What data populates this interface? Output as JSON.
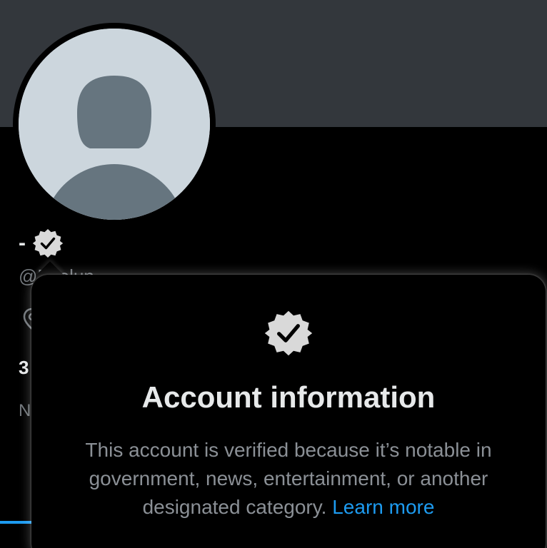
{
  "profile": {
    "display_name": "-",
    "handle_visible": "@D",
    "handle_partial": "lielun",
    "stat_count_partial": "3",
    "tab_label_partial": "N"
  },
  "icons": {
    "avatar": "default-avatar-silhouette",
    "verified": "verified-badge-icon",
    "location": "location-pin-icon"
  },
  "colors": {
    "banner": "#33373c",
    "avatar_bg": "#ccd6dd",
    "avatar_figure": "#66757f",
    "accent": "#1d9bf0",
    "badge": "#d9d9d9"
  },
  "hovercard": {
    "title": "Account information",
    "body": "This account is verified because it’s notable in government, news, entertainment, or another designated category.",
    "link": "Learn more"
  }
}
